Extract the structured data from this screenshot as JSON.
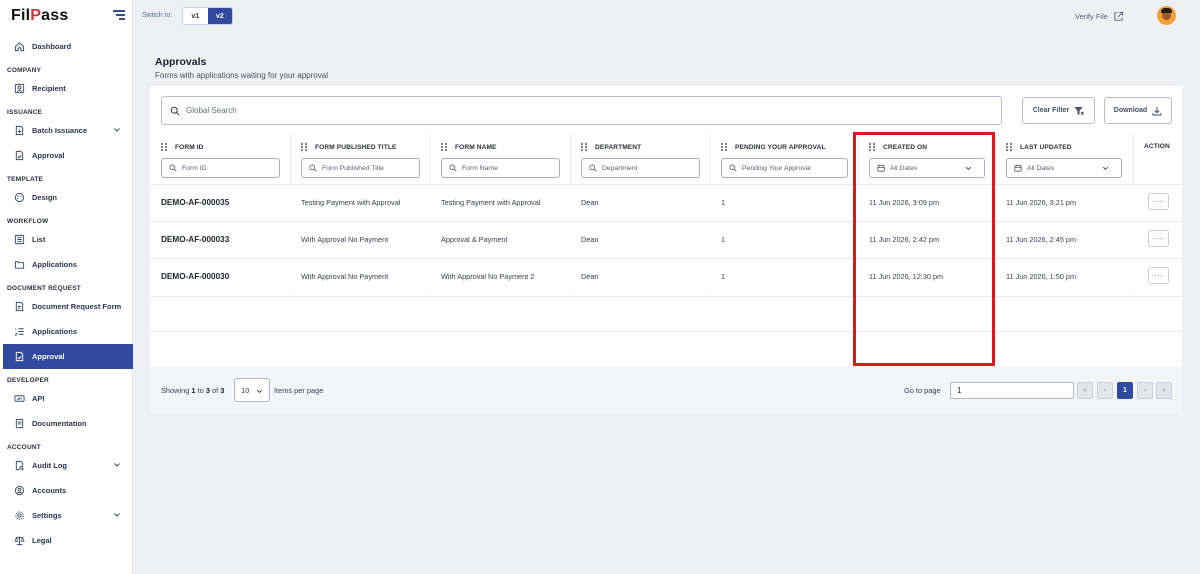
{
  "brand": {
    "logo_prefix": "Fil",
    "logo_accent": "P",
    "logo_suffix": "ass"
  },
  "sidebar": {
    "sections": {
      "company": "COMPANY",
      "issuance": "ISSUANCE",
      "template": "TEMPLATE",
      "workflow": "WORKFLOW",
      "document_request": "DOCUMENT REQUEST",
      "developer": "DEVELOPER",
      "account": "ACCOUNT"
    },
    "items": {
      "dashboard": "Dashboard",
      "recipient": "Recipient",
      "batch_issuance": "Batch Issuance",
      "approval_issuance": "Approval",
      "design": "Design",
      "list": "List",
      "applications_workflow": "Applications",
      "document_request_form": "Document Request Form",
      "applications_docreq": "Applications",
      "approval_active": "Approval",
      "api": "API",
      "documentation": "Documentation",
      "audit_log": "Audit Log",
      "accounts": "Accounts",
      "settings": "Settings",
      "legal": "Legal"
    },
    "active_color": "#2f4a9e"
  },
  "topbar": {
    "switch_label": "Switch to:",
    "versions": [
      "v1",
      "v2"
    ],
    "selected_version": "v2",
    "verify_label": "Verify File"
  },
  "page": {
    "title": "Approvals",
    "subtitle": "Forms with applications waiting for your approval"
  },
  "toolbar": {
    "search_placeholder": "Global Search",
    "clear_filter_label": "Clear Filter",
    "download_label": "Download"
  },
  "table": {
    "columns": [
      {
        "key": "form_id",
        "label": "FORM ID",
        "filter_placeholder": "Form ID"
      },
      {
        "key": "published_title",
        "label": "FORM PUBLISHED TITLE",
        "filter_placeholder": "Form Published Title"
      },
      {
        "key": "form_name",
        "label": "FORM NAME",
        "filter_placeholder": "Form Name"
      },
      {
        "key": "department",
        "label": "DEPARTMENT",
        "filter_placeholder": "Department"
      },
      {
        "key": "pending",
        "label": "PENDING YOUR APPROVAL",
        "filter_placeholder": "Pending Your Approval"
      },
      {
        "key": "created_on",
        "label": "CREATED ON",
        "filter_placeholder": "All Dates"
      },
      {
        "key": "last_updated",
        "label": "LAST UPDATED",
        "filter_placeholder": "All Dates"
      },
      {
        "key": "action",
        "label": "ACTION"
      }
    ],
    "rows": [
      {
        "form_id": "DEMO-AF-000035",
        "published_title": "Testing Payment with Approval",
        "form_name": "Testing Payment with Approval",
        "department": "Dean",
        "pending": "1",
        "created_on": "11 Jun 2026, 3:09 pm",
        "last_updated": "11 Jun 2026, 3:21 pm",
        "action": "···"
      },
      {
        "form_id": "DEMO-AF-000033",
        "published_title": "With Approval No Payment",
        "form_name": "Approval & Payment",
        "department": "Dean",
        "pending": "1",
        "created_on": "11 Jun 2026, 2:42 pm",
        "last_updated": "11 Jun 2026, 2:45 pm",
        "action": "···"
      },
      {
        "form_id": "DEMO-AF-000030",
        "published_title": "With Approval No Payment",
        "form_name": "With Approval No Payment 2",
        "department": "Dean",
        "pending": "1",
        "created_on": "11 Jun 2026, 12:30 pm",
        "last_updated": "11 Jun 2026, 1:50 pm",
        "action": "···"
      }
    ]
  },
  "pagination": {
    "showing_prefix": "Showing",
    "range_start": "1",
    "to_word": "to",
    "range_end": "3",
    "of_word": "of",
    "total": "3",
    "per_page_value": "10",
    "per_page_label": "Items per page",
    "goto_label": "Go to page",
    "goto_value": "1",
    "first": "«",
    "prev": "‹",
    "current": "1",
    "next": "›",
    "last": "»"
  },
  "highlight_color": "#e0141b"
}
